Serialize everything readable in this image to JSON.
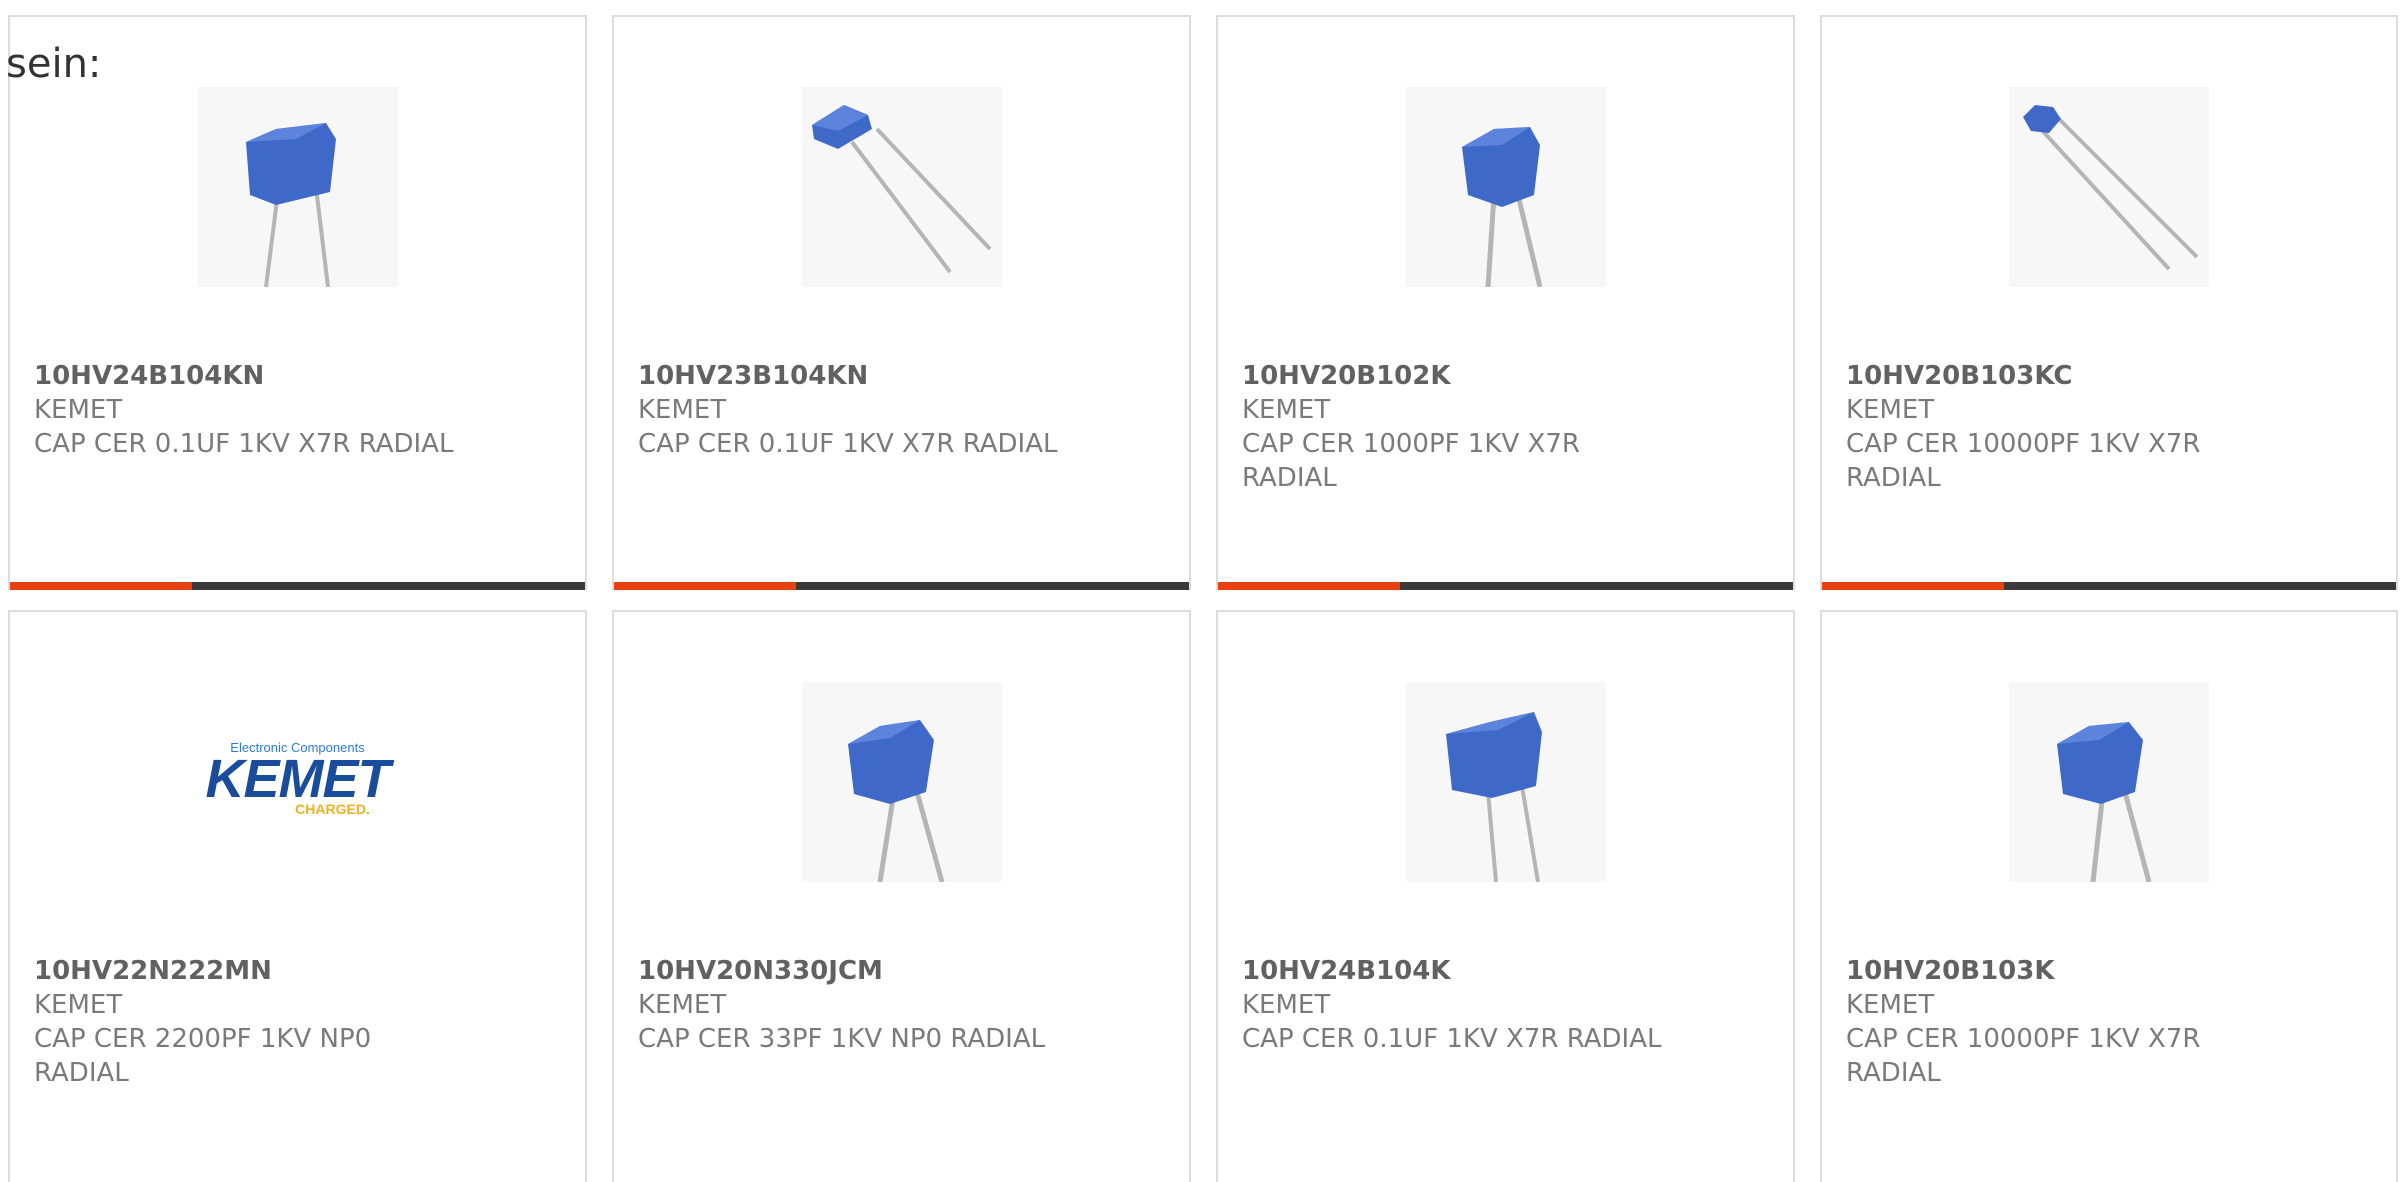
{
  "intro_text": "sein:",
  "colors": {
    "accent": "#e8410f",
    "bar_dark": "#3a3a3a",
    "capacitor_blue": "#3f69c9",
    "kemet_blue": "#1a4c9c",
    "kemet_yellow": "#f2b01e"
  },
  "logo": {
    "tagline": "Electronic Components",
    "brand": "KEMET",
    "sub": "CHARGED."
  },
  "products": [
    {
      "part_number": "10HV24B104KN",
      "manufacturer": "KEMET",
      "description": "CAP CER 0.1UF 1KV X7R RADIAL",
      "image": "capacitor-square-icon"
    },
    {
      "part_number": "10HV23B104KN",
      "manufacturer": "KEMET",
      "description": "CAP CER 0.1UF 1KV X7R RADIAL",
      "image": "capacitor-angled-icon"
    },
    {
      "part_number": "10HV20B102K",
      "manufacturer": "KEMET",
      "description": "CAP CER 1000PF 1KV X7R RADIAL",
      "image": "capacitor-square-icon"
    },
    {
      "part_number": "10HV20B103KC",
      "manufacturer": "KEMET",
      "description": "CAP CER 10000PF 1KV X7R RADIAL",
      "image": "capacitor-small-angled-icon"
    },
    {
      "part_number": "10HV22N222MN",
      "manufacturer": "KEMET",
      "description": "CAP CER 2200PF 1KV NP0 RADIAL",
      "image": "kemet-logo"
    },
    {
      "part_number": "10HV20N330JCM",
      "manufacturer": "KEMET",
      "description": "CAP CER 33PF 1KV NP0 RADIAL",
      "image": "capacitor-square-icon"
    },
    {
      "part_number": "10HV24B104K",
      "manufacturer": "KEMET",
      "description": "CAP CER 0.1UF 1KV X7R RADIAL",
      "image": "capacitor-square-icon"
    },
    {
      "part_number": "10HV20B103K",
      "manufacturer": "KEMET",
      "description": "CAP CER 10000PF 1KV X7R RADIAL",
      "image": "capacitor-square-icon"
    }
  ]
}
